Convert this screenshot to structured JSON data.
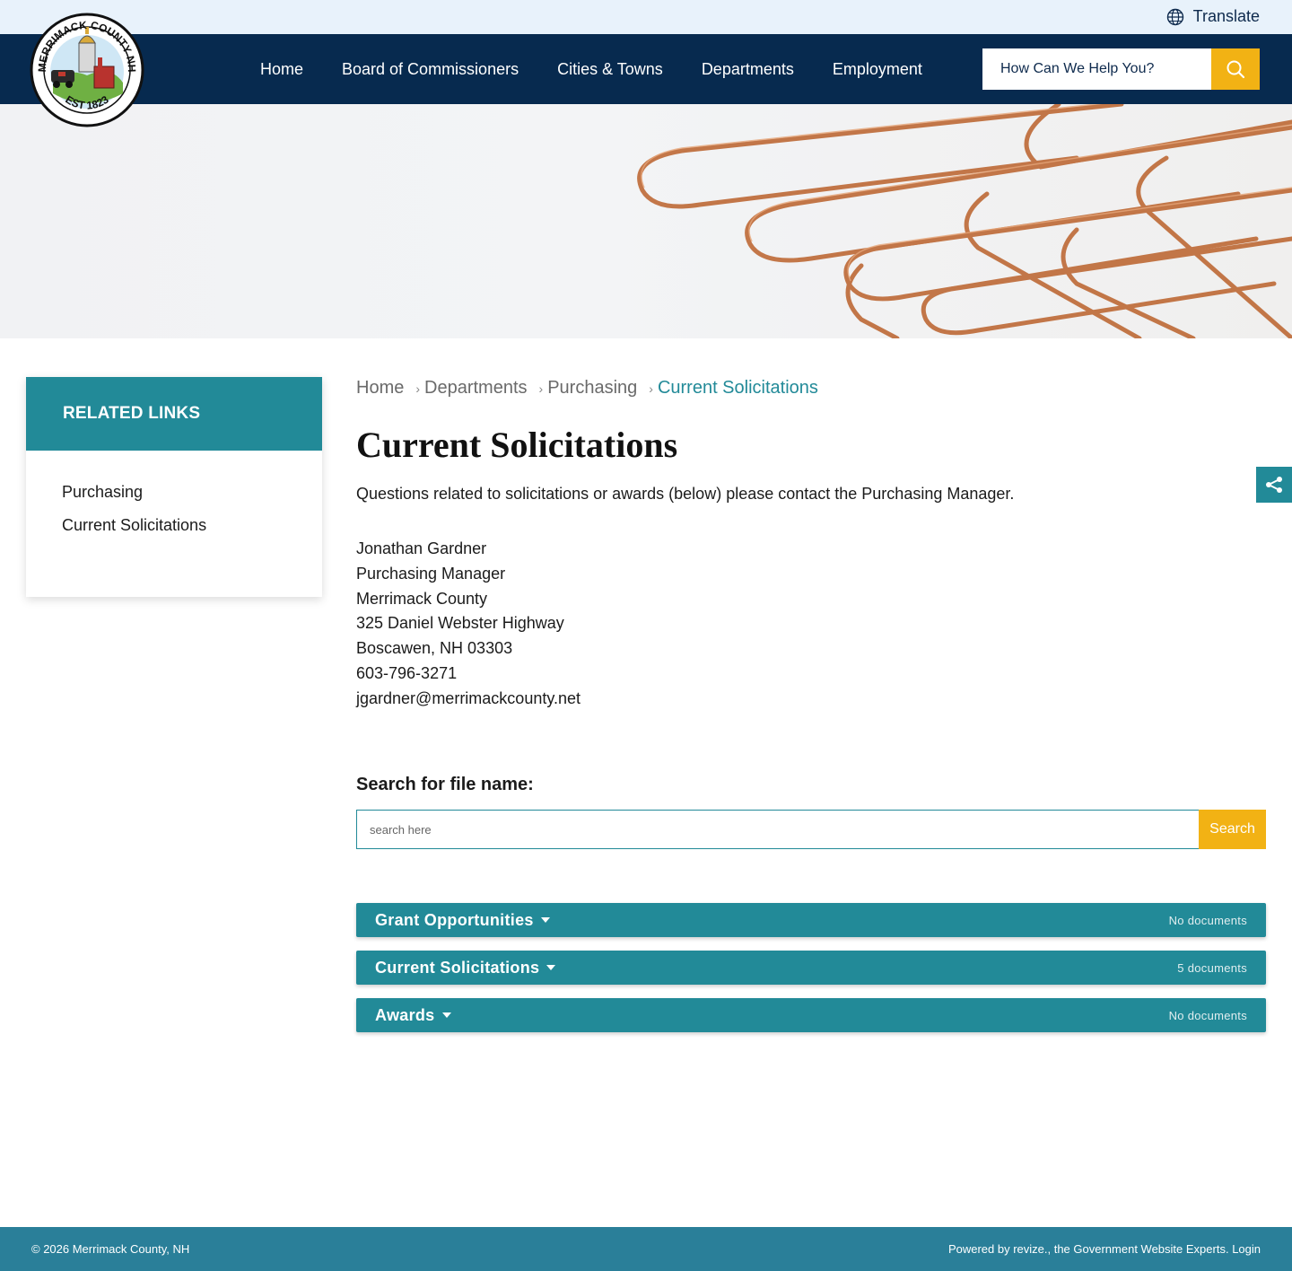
{
  "header": {
    "translate_label": "Translate",
    "logo": {
      "top_text": "MERRIMACK COUNTY NH",
      "bottom_text": "EST 1823"
    },
    "nav": [
      {
        "label": "Home"
      },
      {
        "label": "Board of Commissioners"
      },
      {
        "label": "Cities & Towns"
      },
      {
        "label": "Departments"
      },
      {
        "label": "Employment"
      }
    ],
    "search_placeholder": "How Can We Help You?"
  },
  "sidebar": {
    "heading": "RELATED LINKS",
    "items": [
      {
        "label": "Purchasing"
      },
      {
        "label": "Current Solicitations"
      }
    ]
  },
  "breadcrumb": [
    {
      "label": "Home"
    },
    {
      "label": "Departments"
    },
    {
      "label": "Purchasing"
    },
    {
      "label": "Current Solicitations"
    }
  ],
  "page": {
    "title": "Current Solicitations",
    "intro": "Questions related to solicitations or awards (below) please contact the Purchasing Manager.",
    "contact": [
      "Jonathan Gardner",
      "Purchasing Manager",
      "Merrimack County",
      "325 Daniel Webster Highway",
      "Boscawen, NH 03303",
      "603-796-3271",
      "jgardner@merrimackcounty.net"
    ]
  },
  "file_search": {
    "label": "Search for file name:",
    "placeholder": "search here",
    "button": "Search"
  },
  "folders": [
    {
      "name": "Grant Opportunities",
      "count": "No documents"
    },
    {
      "name": "Current Solicitations",
      "count": "5 documents"
    },
    {
      "name": "Awards",
      "count": "No documents"
    }
  ],
  "footer": {
    "copyright": "© 2026 Merrimack County, NH",
    "powered": "Powered by revize., the Government Website Experts.",
    "login": "Login"
  },
  "colors": {
    "navy": "#072a4f",
    "teal": "#228a98",
    "yellow": "#f2b214",
    "topbar": "#e8f2fb"
  }
}
